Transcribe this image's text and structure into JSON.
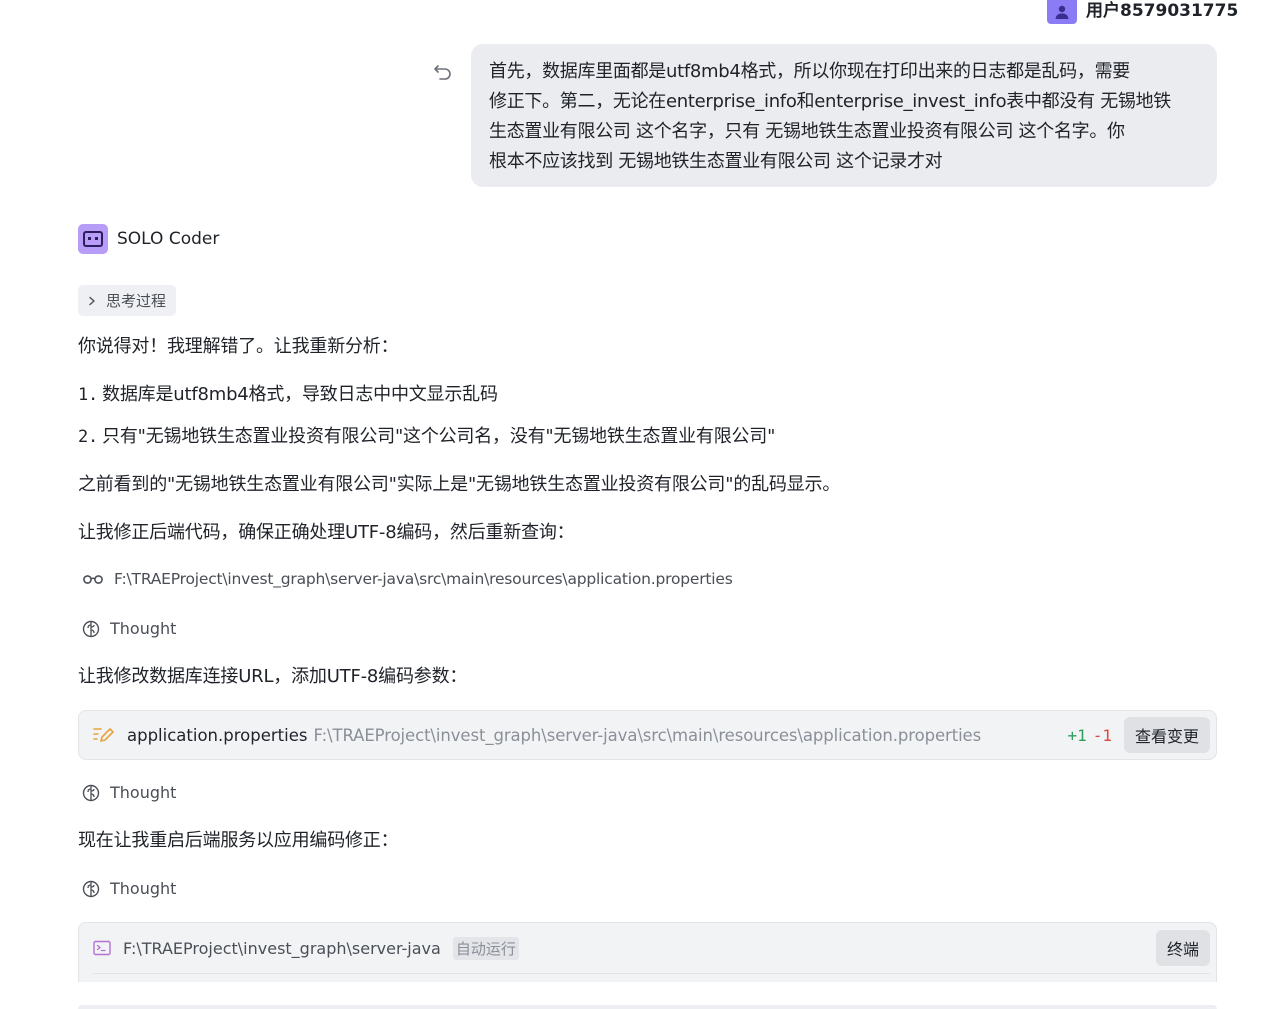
{
  "user": {
    "name": "用户8579031775"
  },
  "user_message": {
    "lines": [
      "首先，数据库里面都是utf8mb4格式，所以你现在打印出来的日志都是乱码，需要",
      "修正下。第二，无论在enterprise_info和enterprise_invest_info表中都没有 无锡地铁",
      "生态置业有限公司 这个名字，只有 无锡地铁生态置业投资有限公司 这个名字。你",
      "根本不应该找到 无锡地铁生态置业有限公司 这个记录才对"
    ]
  },
  "agent": {
    "name": "SOLO Coder",
    "thinking_label": "思考过程",
    "intro": "你说得对！我理解错了。让我重新分析：",
    "list": [
      {
        "num": "1.",
        "text": "数据库是utf8mb4格式，导致日志中中文显示乱码"
      },
      {
        "num": "2.",
        "text": "只有\"无锡地铁生态置业投资有限公司\"这个公司名，没有\"无锡地铁生态置业有限公司\""
      }
    ],
    "para1": "之前看到的\"无锡地铁生态置业有限公司\"实际上是\"无锡地铁生态置业投资有限公司\"的乱码显示。",
    "para2": "让我修正后端代码，确保正确处理UTF-8编码，然后重新查询：",
    "read_file": "F:\\TRAEProject\\invest_graph\\server-java\\src\\main\\resources\\application.properties",
    "thought_label": "Thought",
    "para3": "让我修改数据库连接URL，添加UTF-8编码参数：",
    "edit": {
      "file_name": "application.properties",
      "file_path": "F:\\TRAEProject\\invest_graph\\server-java\\src\\main\\resources\\application.properties",
      "added": "+1",
      "removed": "-1",
      "view_changes": "查看变更"
    },
    "para4": "现在让我重启后端服务以应用编码修正：",
    "terminal": {
      "path": "F:\\TRAEProject\\invest_graph\\server-java",
      "auto_run": "自动运行",
      "button": "终端"
    }
  },
  "colors": {
    "user_bubble": "#ebecef",
    "agent_avatar": "#b79cf8",
    "user_avatar": "#8b7cf6",
    "diff_add": "#2f9e5c",
    "diff_del": "#e0473e"
  }
}
